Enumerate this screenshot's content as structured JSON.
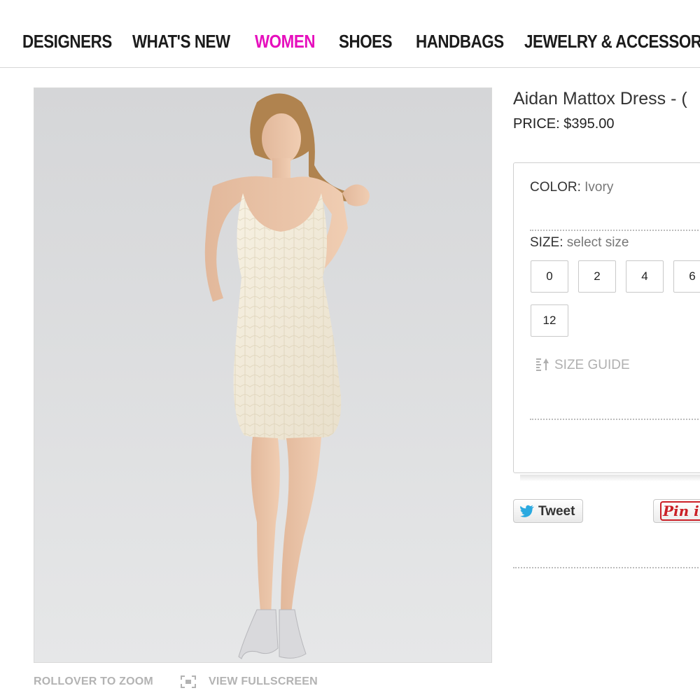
{
  "nav": {
    "items": [
      {
        "label": "DESIGNERS"
      },
      {
        "label": "WHAT'S NEW"
      },
      {
        "label": "WOMEN",
        "active": true
      },
      {
        "label": "SHOES"
      },
      {
        "label": "HANDBAGS"
      },
      {
        "label": "JEWELRY & ACCESSORI"
      }
    ],
    "active_color": "#e60fbd"
  },
  "product": {
    "title": "Aidan Mattox Dress - (",
    "price_label": "PRICE:",
    "price": "$395.00"
  },
  "options": {
    "color_label": "COLOR:",
    "color_value": "Ivory",
    "size_label": "SIZE:",
    "size_value": "select size",
    "sizes": [
      "0",
      "2",
      "4",
      "6",
      "12"
    ],
    "size_guide": "SIZE GUIDE"
  },
  "image_tools": {
    "zoom": "ROLLOVER TO ZOOM",
    "fullscreen": "VIEW FULLSCREEN"
  },
  "social": {
    "tweet": "Tweet",
    "pin": "Pin it"
  },
  "icons": [
    "ruler-icon",
    "fullscreen-icon",
    "twitter-bird-icon"
  ]
}
